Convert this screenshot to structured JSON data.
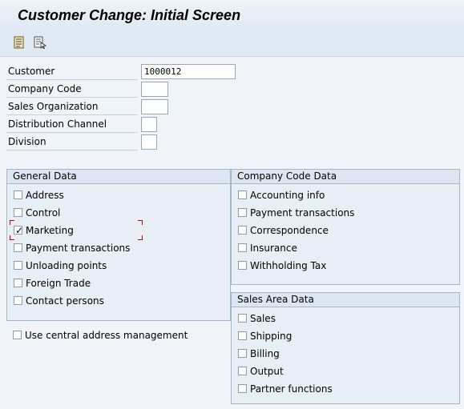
{
  "title": "Customer Change: Initial Screen",
  "toolbar": {
    "icons": [
      "document-list-icon",
      "document-select-icon"
    ]
  },
  "fields": {
    "customer": {
      "label": "Customer",
      "value": "1000012"
    },
    "company_code": {
      "label": "Company Code",
      "value": ""
    },
    "sales_org": {
      "label": "Sales Organization",
      "value": ""
    },
    "distribution_channel": {
      "label": "Distribution Channel",
      "value": ""
    },
    "division": {
      "label": "Division",
      "value": ""
    }
  },
  "general_data": {
    "title": "General Data",
    "items": [
      {
        "label": "Address",
        "checked": false
      },
      {
        "label": "Control",
        "checked": false
      },
      {
        "label": "Marketing",
        "checked": true
      },
      {
        "label": "Payment transactions",
        "checked": false
      },
      {
        "label": "Unloading points",
        "checked": false
      },
      {
        "label": "Foreign Trade",
        "checked": false
      },
      {
        "label": "Contact persons",
        "checked": false
      }
    ]
  },
  "company_code_data": {
    "title": "Company Code Data",
    "items": [
      {
        "label": "Accounting info",
        "checked": false
      },
      {
        "label": "Payment transactions",
        "checked": false
      },
      {
        "label": "Correspondence",
        "checked": false
      },
      {
        "label": "Insurance",
        "checked": false
      },
      {
        "label": "Withholding Tax",
        "checked": false
      }
    ]
  },
  "sales_area_data": {
    "title": "Sales Area Data",
    "items": [
      {
        "label": "Sales",
        "checked": false
      },
      {
        "label": "Shipping",
        "checked": false
      },
      {
        "label": "Billing",
        "checked": false
      },
      {
        "label": "Output",
        "checked": false
      },
      {
        "label": "Partner functions",
        "checked": false
      }
    ]
  },
  "central_address": {
    "label": "Use central address management",
    "checked": false
  },
  "colors": {
    "background": "#dfe8f3",
    "group_border": "#a6b6c9",
    "focus": "#cc0000"
  }
}
